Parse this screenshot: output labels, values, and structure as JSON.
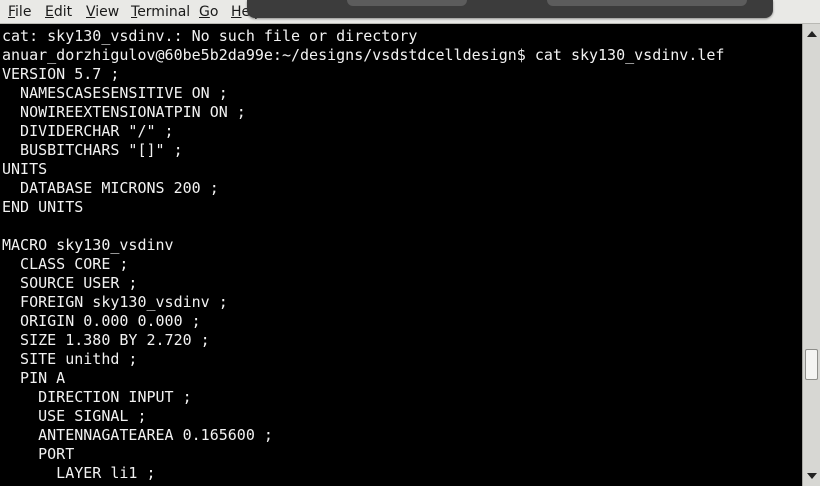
{
  "menubar": {
    "items": [
      {
        "mnemonic": "F",
        "rest": "ile"
      },
      {
        "mnemonic": "E",
        "rest": "dit"
      },
      {
        "mnemonic": "V",
        "rest": "iew"
      },
      {
        "mnemonic": "T",
        "rest": "erminal"
      },
      {
        "mnemonic": "G",
        "rest": "o"
      },
      {
        "mnemonic": "H",
        "rest": "elp"
      }
    ]
  },
  "terminal": {
    "lines": [
      "cat: sky130_vsdinv.: No such file or directory",
      "anuar_dorzhigulov@60be5b2da99e:~/designs/vsdstdcelldesign$ cat sky130_vsdinv.lef",
      "VERSION 5.7 ;",
      "  NAMESCASESENSITIVE ON ;",
      "  NOWIREEXTENSIONATPIN ON ;",
      "  DIVIDERCHAR \"/\" ;",
      "  BUSBITCHARS \"[]\" ;",
      "UNITS",
      "  DATABASE MICRONS 200 ;",
      "END UNITS",
      "",
      "MACRO sky130_vsdinv",
      "  CLASS CORE ;",
      "  SOURCE USER ;",
      "  FOREIGN sky130_vsdinv ;",
      "  ORIGIN 0.000 0.000 ;",
      "  SIZE 1.380 BY 2.720 ;",
      "  SITE unithd ;",
      "  PIN A",
      "    DIRECTION INPUT ;",
      "    USE SIGNAL ;",
      "    ANTENNAGATEAREA 0.165600 ;",
      "    PORT",
      "      LAYER li1 ;"
    ]
  },
  "scrollbar": {
    "scroll_position": 0.78
  }
}
